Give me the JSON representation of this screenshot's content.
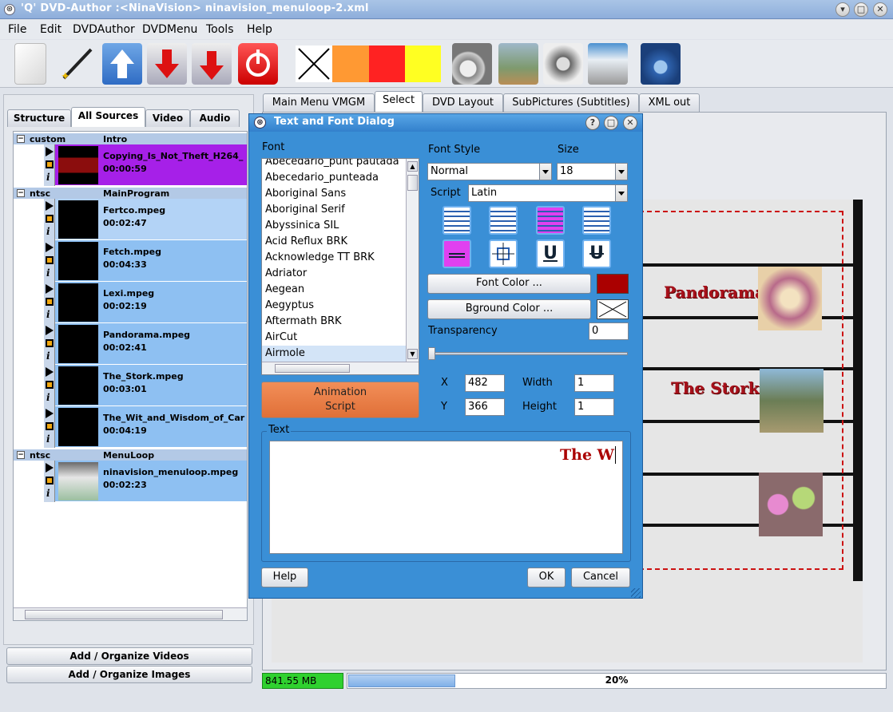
{
  "window": {
    "title": "'Q' DVD-Author :<NinaVision> ninavision_menuloop-2.xml"
  },
  "menu": [
    "File",
    "Edit",
    "DVDAuthor",
    "DVDMenu",
    "Tools",
    "Help"
  ],
  "toolbar": {
    "icons": [
      "new-file-icon",
      "wizard-wand-icon",
      "import-icon",
      "export-icon",
      "export-all-icon",
      "power-icon",
      "x-swatch-icon",
      "orange-swatch",
      "red-swatch",
      "yellow-swatch",
      "dvd-movie-icon",
      "image-icon",
      "sound-icon",
      "camera-icon",
      "user-icon"
    ],
    "swatch_colors": [
      "#ff9933",
      "#ff2222",
      "#ffff22"
    ]
  },
  "left_tabs": [
    "Structure",
    "All Sources",
    "Video",
    "Audio"
  ],
  "tree": {
    "groups": [
      {
        "type": "custom",
        "name": "Intro",
        "items": [
          {
            "file": "Copying_Is_Not_Theft_H264_",
            "duration": "00:00:59",
            "color": "#a620e8"
          }
        ]
      },
      {
        "type": "ntsc",
        "name": "MainProgram",
        "items": [
          {
            "file": "Fertco.mpeg",
            "duration": "00:02:47"
          },
          {
            "file": "Fetch.mpeg",
            "duration": "00:04:33"
          },
          {
            "file": "Lexi.mpeg",
            "duration": "00:02:19"
          },
          {
            "file": "Pandorama.mpeg",
            "duration": "00:02:41"
          },
          {
            "file": "The_Stork.mpeg",
            "duration": "00:03:01"
          },
          {
            "file": "The_Wit_and_Wisdom_of_Car",
            "duration": "00:04:19"
          }
        ]
      },
      {
        "type": "ntsc",
        "name": "MenuLoop",
        "items": [
          {
            "file": "ninavision_menuloop.mpeg",
            "duration": "00:02:23"
          }
        ]
      }
    ]
  },
  "left_buttons": {
    "videos": "Add / Organize Videos",
    "images": "Add / Organize Images"
  },
  "right_tabs": [
    "Main Menu VMGM",
    "Select",
    "DVD Layout",
    "SubPictures (Subtitles)",
    "XML out"
  ],
  "canvas": {
    "items": [
      "Pandorama",
      "The Stork"
    ]
  },
  "status": {
    "size": "841.55 MB",
    "progress_text": "20%",
    "progress": 0.2
  },
  "dialog": {
    "title": "Text and Font Dialog",
    "font_label": "Font",
    "fonts": [
      "Abecedario_punt pautada",
      "Abecedario_punteada",
      "Aboriginal Sans",
      "Aboriginal Serif",
      "Abyssinica SIL",
      "Acid Reflux BRK",
      "Acknowledge TT BRK",
      "Adriator",
      "Aegean",
      "Aegyptus",
      "Aftermath BRK",
      "AirCut",
      "Airmole"
    ],
    "selected_font": "Airmole",
    "font_style_label": "Font Style",
    "font_style": "Normal",
    "size_label": "Size",
    "size": "18",
    "script_label": "Script",
    "script": "Latin",
    "font_color_btn": "Font Color ...",
    "font_color": "#aa0000",
    "bg_color_btn": "Bground Color ...",
    "transparency_label": "Transparency",
    "transparency": "0",
    "animation_btn_line1": "Animation",
    "animation_btn_line2": "Script",
    "x_label": "X",
    "x": "482",
    "y_label": "Y",
    "y": "366",
    "width_label": "Width",
    "width": "1",
    "height_label": "Height",
    "height": "1",
    "text_label": "Text",
    "text_value": "The W",
    "help_btn": "Help",
    "ok_btn": "OK",
    "cancel_btn": "Cancel"
  }
}
